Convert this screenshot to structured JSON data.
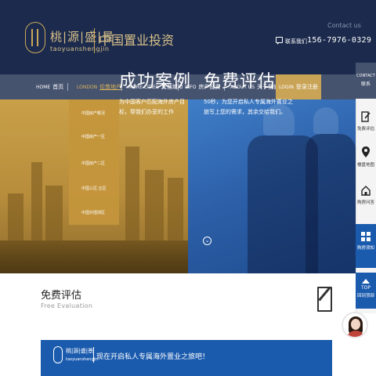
{
  "header": {
    "logo_cn": "桃|源|盛|景",
    "logo_en": "taoyuanshengjin",
    "tagline": "中国置业投资",
    "contact_en": "Contact us",
    "contact_label": "联系我们",
    "phone": "156-7976-0329"
  },
  "nav": {
    "items": [
      {
        "en": "HOME",
        "cn": "首页"
      },
      {
        "en": "LONDON",
        "cn": "伦敦地产"
      },
      {
        "en": "MORE CITIES",
        "cn": "其他城市"
      },
      {
        "en": "INFO",
        "cn": "房产投资"
      },
      {
        "en": "ABOUT US",
        "cn": "关于我们"
      }
    ],
    "login": {
      "en": "LOGIN",
      "cn": "登录注册"
    }
  },
  "dropdown": {
    "items": [
      "中国房产概况",
      "中国房产一区",
      "中国房产二区",
      "中国三区-五区",
      "中国外围郊区"
    ]
  },
  "banner": {
    "left_title": "成功案例",
    "left_desc": "为中国客户匹配海外房产目标，帮我们办妥的工作",
    "right_title": "免费评估",
    "right_desc": "50秒，为您开启私人专属海外置业之旅写上您的需求，其余交给我们。"
  },
  "section": {
    "title": "免费评估",
    "subtitle": "Free Evaluation"
  },
  "form_banner": {
    "logo_cn": "桃|源|盛|景",
    "logo_en": "taoyuanshengjin",
    "text": "现在开启私人专属海外置业之旅吧！"
  },
  "sidebar": {
    "contact_en": "CONTACT",
    "contact_cn": "联系",
    "items": [
      {
        "label": "免费评估",
        "icon": "edit-icon"
      },
      {
        "label": "楼盘地图",
        "icon": "map-pin-icon"
      },
      {
        "label": "购房问答",
        "icon": "home-icon"
      },
      {
        "label": "购房须知",
        "icon": "grid-icon"
      }
    ],
    "top": "TOP",
    "top_cn": "回到顶部"
  },
  "colors": {
    "header_bg": "#1c2b4d",
    "nav_bg": "#46536f",
    "gold": "#c9a356",
    "blue": "#1b5bae"
  }
}
